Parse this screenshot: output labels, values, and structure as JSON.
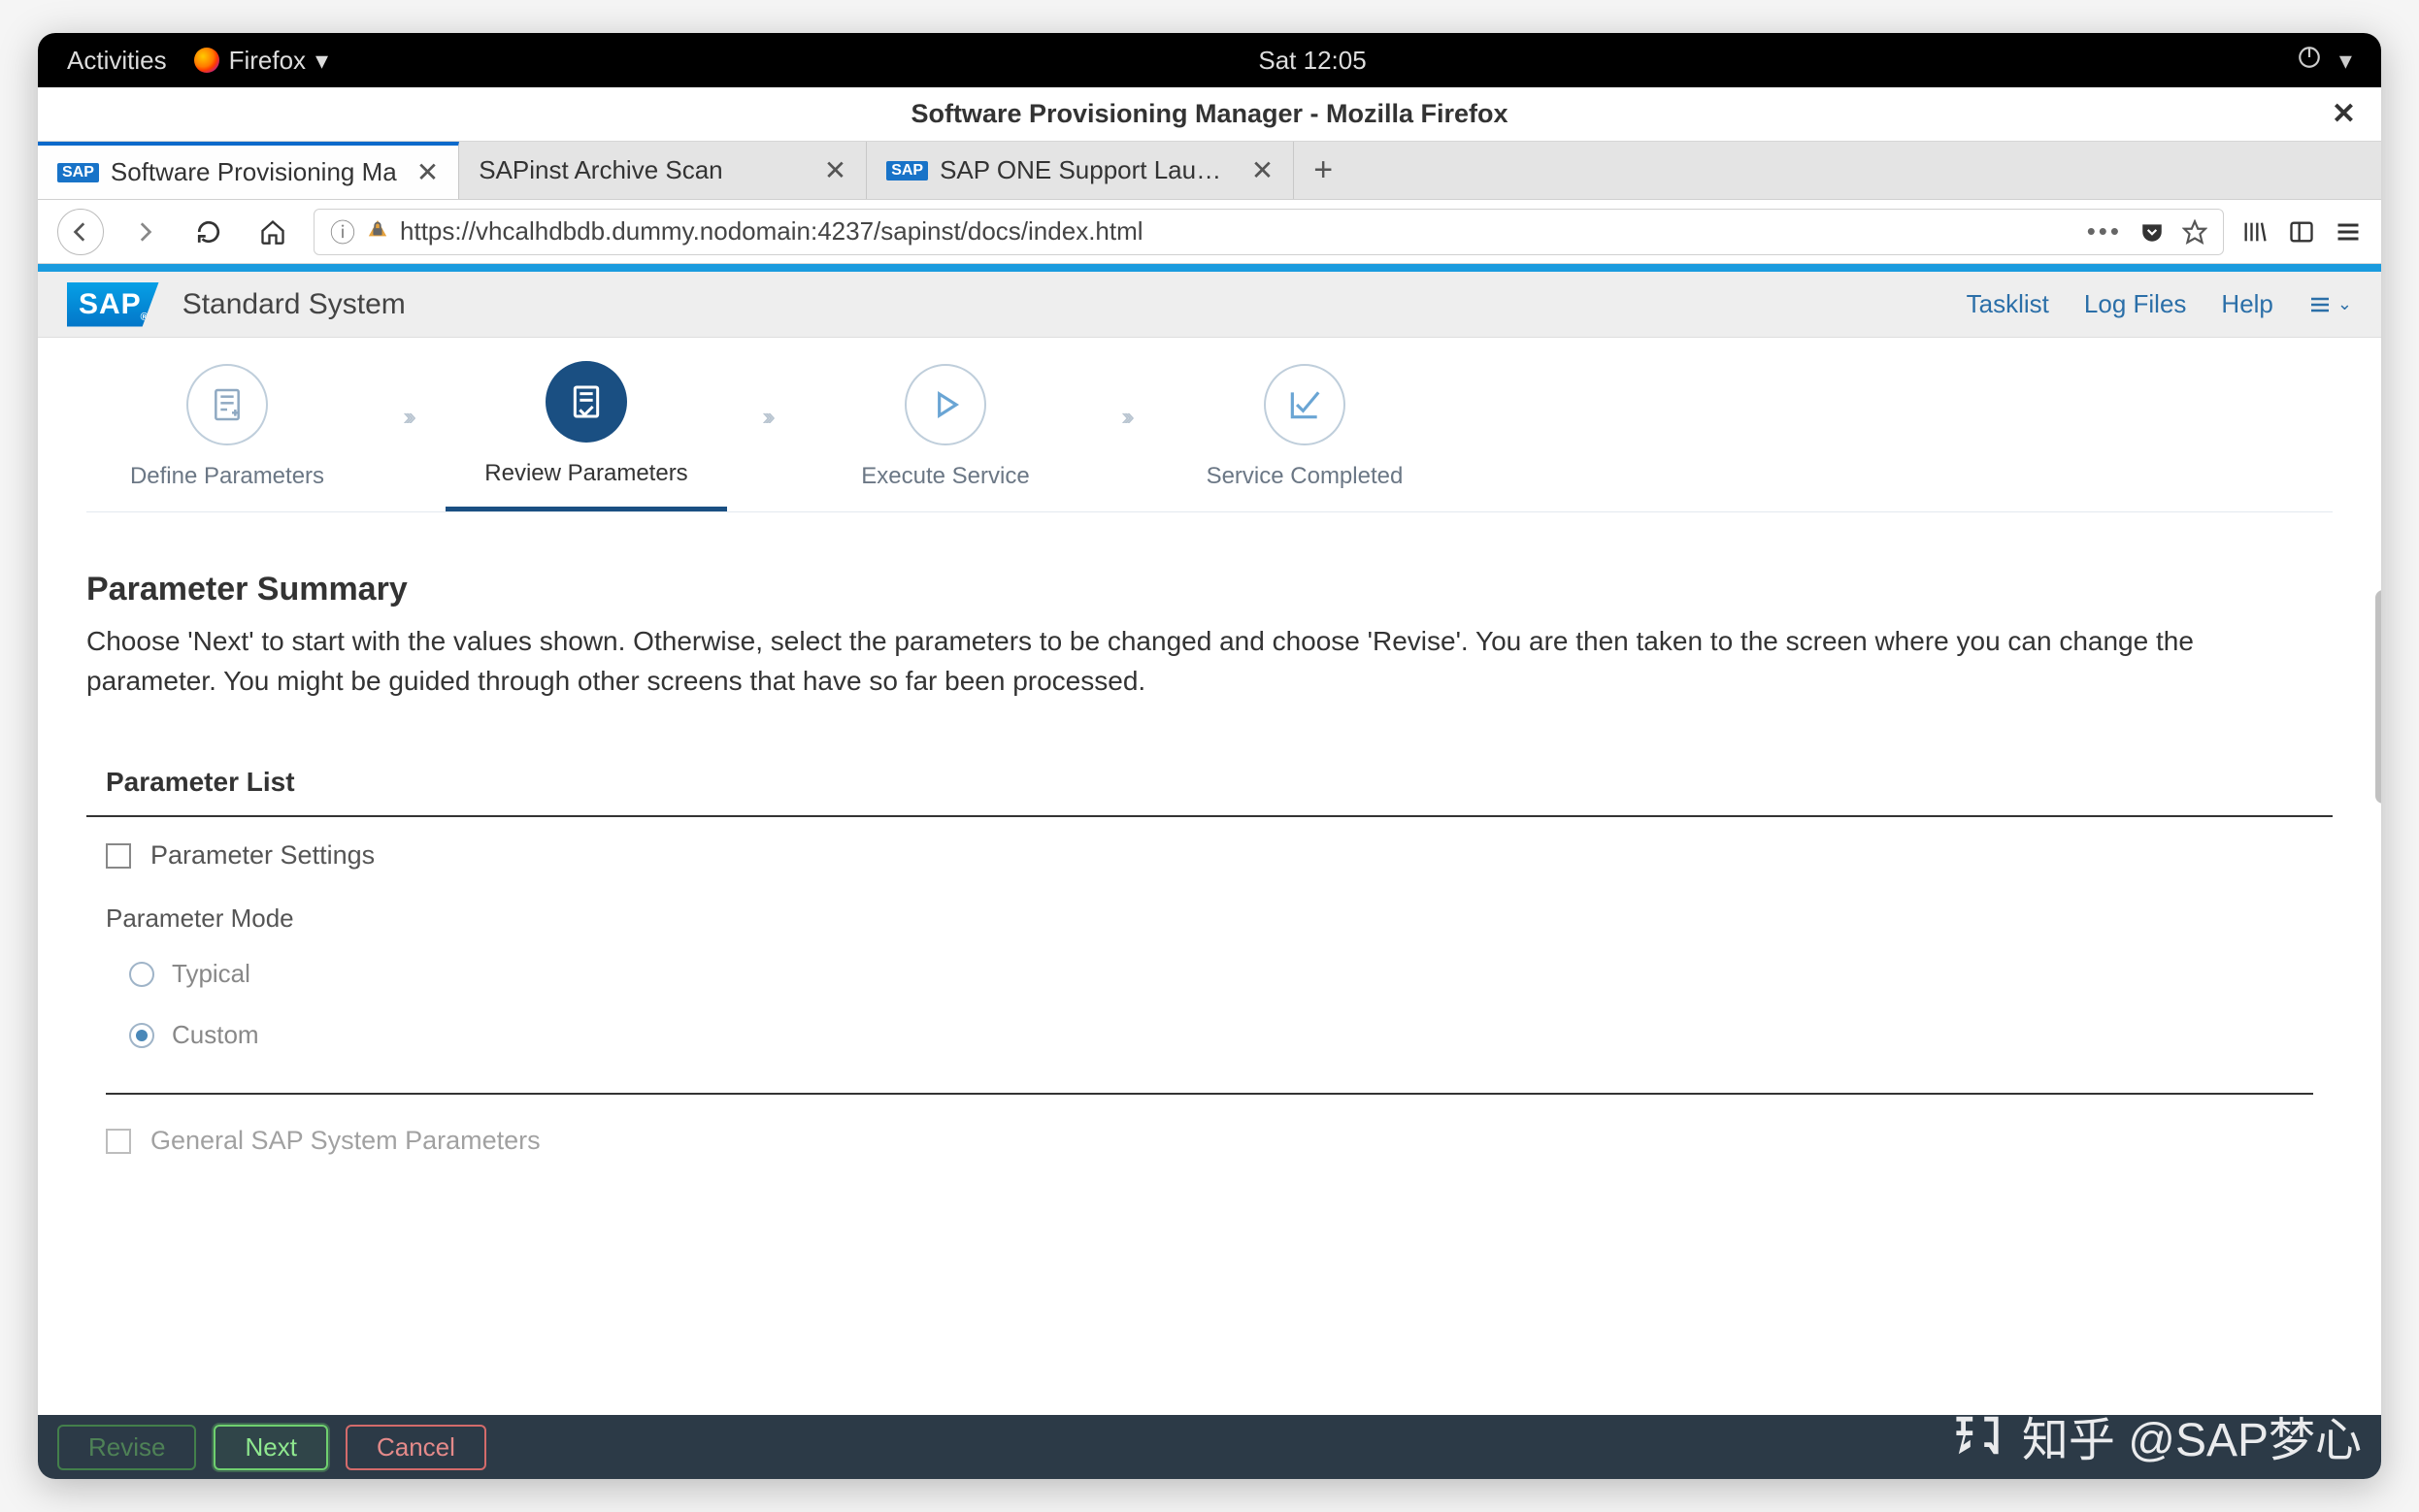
{
  "gnome": {
    "activities": "Activities",
    "app": "Firefox",
    "clock": "Sat 12:05"
  },
  "firefox": {
    "window_title": "Software Provisioning Manager - Mozilla Firefox",
    "tabs": [
      {
        "label": "Software Provisioning Ma"
      },
      {
        "label": "SAPinst Archive Scan"
      },
      {
        "label": "SAP ONE Support Launch"
      }
    ],
    "url": "https://vhcalhdbdb.dummy.nodomain:4237/sapinst/docs/index.html"
  },
  "sap": {
    "logo": "SAP",
    "title": "Standard System",
    "links": {
      "tasklist": "Tasklist",
      "logfiles": "Log Files",
      "help": "Help"
    },
    "steps": {
      "define": "Define Parameters",
      "review": "Review Parameters",
      "execute": "Execute Service",
      "complete": "Service Completed"
    }
  },
  "content": {
    "heading": "Parameter Summary",
    "desc": "Choose 'Next' to start with the values shown. Otherwise, select the parameters to be changed and choose 'Revise'. You are then taken to the screen where you can change the parameter. You might be guided through other screens that have so far been processed.",
    "paramlist": "Parameter List",
    "section1": "Parameter Settings",
    "mode_label": "Parameter Mode",
    "mode_typical": "Typical",
    "mode_custom": "Custom",
    "section2": "General SAP System Parameters"
  },
  "footer": {
    "revise": "Revise",
    "next": "Next",
    "cancel": "Cancel"
  },
  "watermark": "知乎 @SAP梦心"
}
